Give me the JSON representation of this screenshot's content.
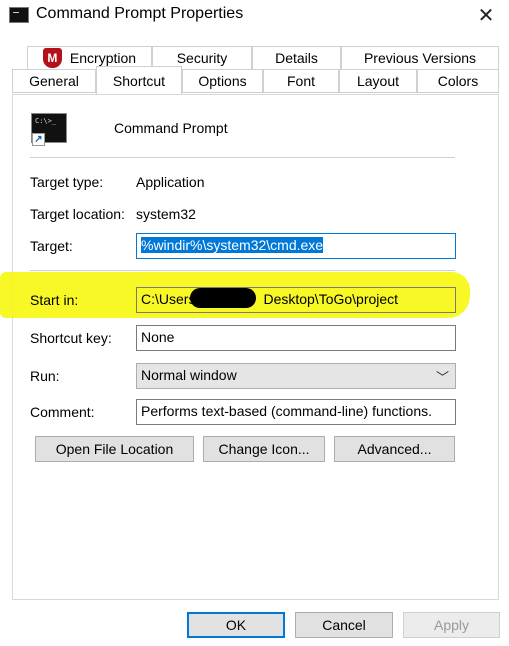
{
  "window": {
    "title": "Command Prompt Properties",
    "close_glyph": "✕"
  },
  "tabs": {
    "row_back": [
      "Encryption",
      "Security",
      "Details",
      "Previous Versions"
    ],
    "row_front": [
      "General",
      "Shortcut",
      "Options",
      "Font",
      "Layout",
      "Colors"
    ],
    "active": "Shortcut"
  },
  "app": {
    "name": "Command Prompt",
    "icon": "command-prompt-icon"
  },
  "fields": {
    "target_type": {
      "label": "Target type:",
      "value": "Application"
    },
    "target_location": {
      "label": "Target location:",
      "value": "system32"
    },
    "target": {
      "label": "Target:",
      "value": "%windir%\\system32\\cmd.exe"
    },
    "start_in": {
      "label": "Start in:",
      "value_prefix": "C:\\Users",
      "value_suffix": "Desktop\\ToGo\\project"
    },
    "shortcut_key": {
      "label": "Shortcut key:",
      "value": "None"
    },
    "run": {
      "label": "Run:",
      "value": "Normal window"
    },
    "comment": {
      "label": "Comment:",
      "value": "Performs text-based (command-line) functions."
    }
  },
  "buttons": {
    "open_file_location": "Open File Location",
    "change_icon": "Change Icon...",
    "advanced": "Advanced...",
    "ok": "OK",
    "cancel": "Cancel",
    "apply": "Apply"
  },
  "colors": {
    "accent": "#0078d7",
    "highlight": "#f7f700",
    "encryption_badge": "#b3121a"
  }
}
